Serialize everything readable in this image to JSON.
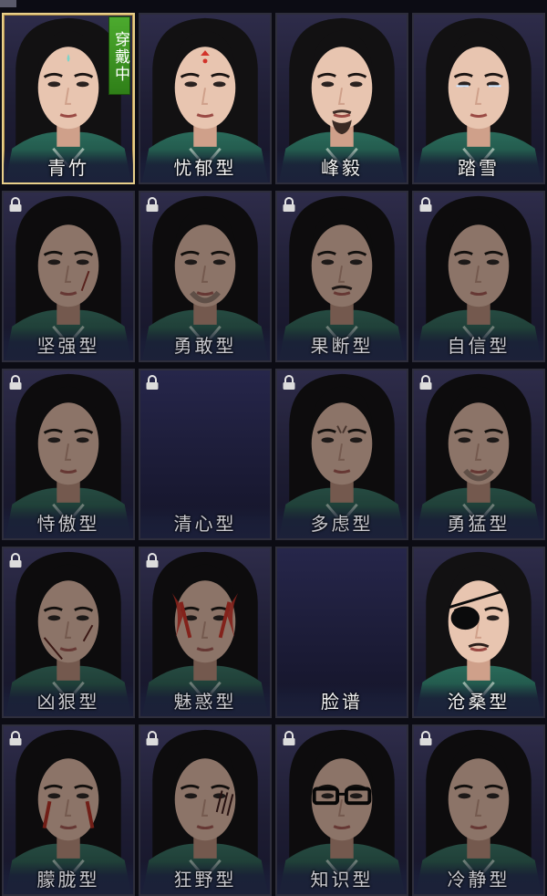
{
  "badge": {
    "wearing": "穿戴中"
  },
  "styles": [
    {
      "label": "青竹",
      "locked": false,
      "selected": true,
      "mark": "tear",
      "empty": false
    },
    {
      "label": "忧郁型",
      "locked": false,
      "selected": false,
      "mark": "forehead",
      "empty": false
    },
    {
      "label": "峰毅",
      "locked": false,
      "selected": false,
      "mark": "beard",
      "empty": false
    },
    {
      "label": "踏雪",
      "locked": false,
      "selected": false,
      "mark": "frost",
      "empty": false
    },
    {
      "label": "坚强型",
      "locked": true,
      "selected": false,
      "mark": "scar",
      "empty": false
    },
    {
      "label": "勇敢型",
      "locked": true,
      "selected": false,
      "mark": "stubble",
      "empty": false
    },
    {
      "label": "果断型",
      "locked": true,
      "selected": false,
      "mark": "mustache",
      "empty": false
    },
    {
      "label": "自信型",
      "locked": true,
      "selected": false,
      "mark": "none",
      "empty": false
    },
    {
      "label": "恃傲型",
      "locked": true,
      "selected": false,
      "mark": "none",
      "empty": false
    },
    {
      "label": "清心型",
      "locked": true,
      "selected": false,
      "mark": "none",
      "empty": true
    },
    {
      "label": "多虑型",
      "locked": true,
      "selected": false,
      "mark": "frown",
      "empty": false
    },
    {
      "label": "勇猛型",
      "locked": true,
      "selected": false,
      "mark": "stubble",
      "empty": false
    },
    {
      "label": "凶狠型",
      "locked": true,
      "selected": false,
      "mark": "scars",
      "empty": false
    },
    {
      "label": "魅惑型",
      "locked": true,
      "selected": false,
      "mark": "redpaint",
      "empty": false
    },
    {
      "label": "脸谱",
      "locked": false,
      "selected": false,
      "mark": "none",
      "empty": true
    },
    {
      "label": "沧桑型",
      "locked": false,
      "selected": false,
      "mark": "eyepatch",
      "empty": false
    },
    {
      "label": "朦胧型",
      "locked": true,
      "selected": false,
      "mark": "redstreak",
      "empty": false
    },
    {
      "label": "狂野型",
      "locked": true,
      "selected": false,
      "mark": "claw",
      "empty": false
    },
    {
      "label": "知识型",
      "locked": true,
      "selected": false,
      "mark": "glasses",
      "empty": false
    },
    {
      "label": "冷静型",
      "locked": true,
      "selected": false,
      "mark": "none",
      "empty": false
    }
  ],
  "colors": {
    "selected_border": "#e8cf8a",
    "badge_green": "#3f9a22",
    "robe_teal": "#1f5a4c",
    "skin_light": "#e9c7b3",
    "hair": "#121112"
  },
  "icons": {
    "lock": "lock-icon"
  }
}
